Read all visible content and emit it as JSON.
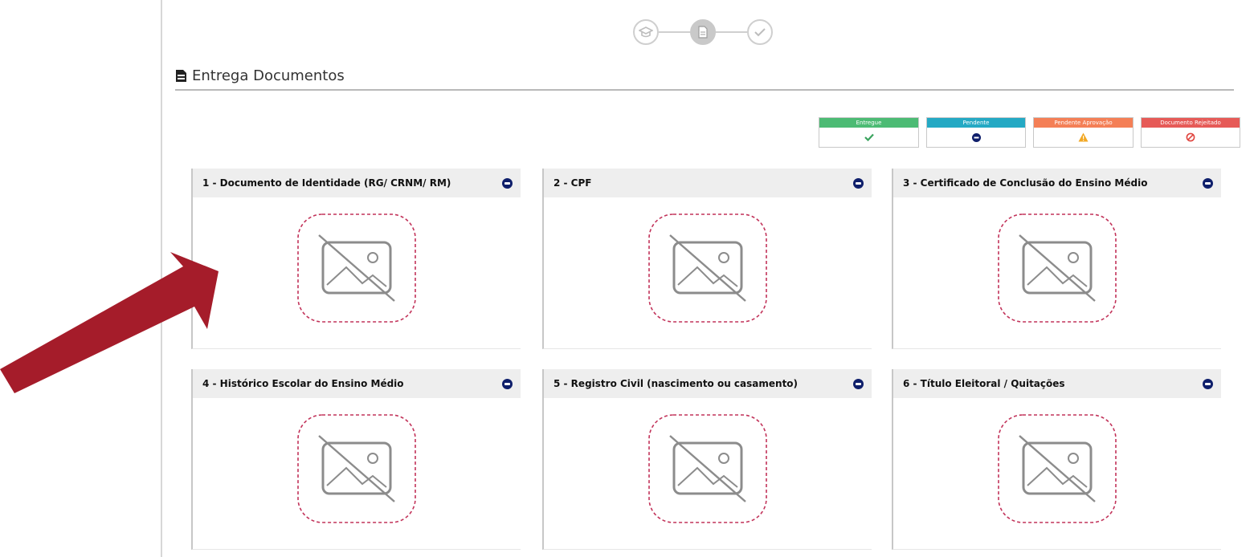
{
  "page": {
    "section_title": "Entrega Documentos"
  },
  "steps": [
    {
      "icon": "graduation-cap-icon",
      "state": "done"
    },
    {
      "icon": "document-icon",
      "state": "current"
    },
    {
      "icon": "check-icon",
      "state": "pending"
    }
  ],
  "legend": [
    {
      "label": "Entregue",
      "color": "#4cbb74",
      "icon": "check-icon"
    },
    {
      "label": "Pendente",
      "color": "#24a9c4",
      "icon": "minus-circle-icon"
    },
    {
      "label": "Pendente Aprovação",
      "color": "#f47f56",
      "icon": "warning-icon"
    },
    {
      "label": "Documento Rejeitado",
      "color": "#e65a57",
      "icon": "ban-icon"
    }
  ],
  "documents": [
    {
      "title": "1 - Documento de Identidade (RG/ CRNM/ RM)",
      "status_icon": "minus-circle-icon"
    },
    {
      "title": "2 - CPF",
      "status_icon": "minus-circle-icon"
    },
    {
      "title": "3 - Certificado de Conclusão do Ensino Médio",
      "status_icon": "minus-circle-icon"
    },
    {
      "title": "4 - Histórico Escolar do Ensino Médio",
      "status_icon": "minus-circle-icon"
    },
    {
      "title": "5 - Registro Civil (nascimento ou casamento)",
      "status_icon": "minus-circle-icon"
    },
    {
      "title": "6 - Título Eleitoral / Quitações",
      "status_icon": "minus-circle-icon"
    }
  ],
  "colors": {
    "status_pending": "#0f1f6b",
    "placeholder_border": "#c2335a",
    "arrow": "#a51c2a"
  }
}
